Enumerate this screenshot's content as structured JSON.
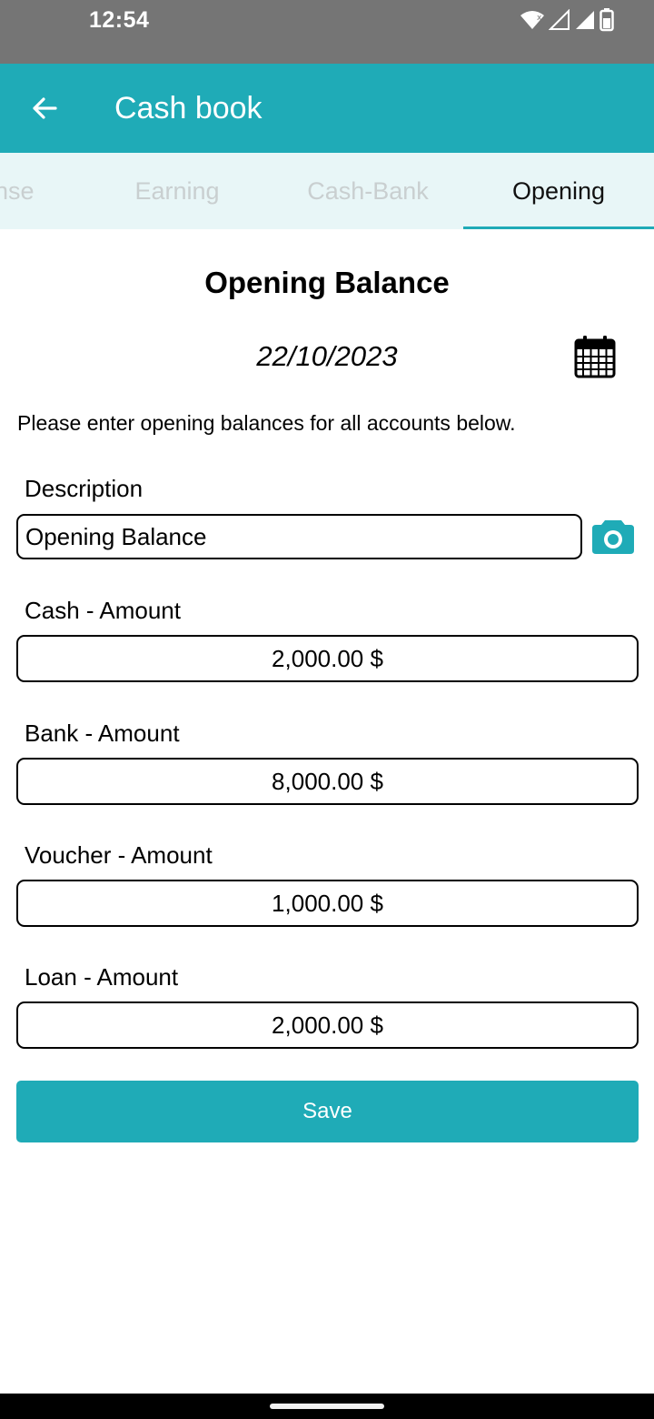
{
  "status_bar": {
    "time": "12:54"
  },
  "app_bar": {
    "title": "Cash book"
  },
  "tabs": [
    {
      "label": "Expense"
    },
    {
      "label": "Earning"
    },
    {
      "label": "Cash-Bank"
    },
    {
      "label": "Opening"
    }
  ],
  "active_tab": "Opening",
  "page": {
    "title": "Opening Balance",
    "date": "22/10/2023",
    "instruction": "Please enter opening balances for all accounts below."
  },
  "form": {
    "description": {
      "label": "Description",
      "value": "Opening Balance"
    },
    "cash": {
      "label": "Cash - Amount",
      "value": "2,000.00 $"
    },
    "bank": {
      "label": "Bank - Amount",
      "value": "8,000.00 $"
    },
    "voucher": {
      "label": "Voucher - Amount",
      "value": "1,000.00 $"
    },
    "loan": {
      "label": "Loan - Amount",
      "value": "2,000.00 $"
    }
  },
  "save_button": {
    "label": "Save"
  },
  "icons": {
    "back": "arrow-left-icon",
    "calendar": "calendar-icon",
    "camera": "camera-icon",
    "wifi": "wifi-icon",
    "signal": "signal-icon",
    "battery": "battery-icon"
  },
  "colors": {
    "accent": "#1FABB7",
    "tab_background": "#E8F6F7",
    "status_bar": "#757575"
  }
}
